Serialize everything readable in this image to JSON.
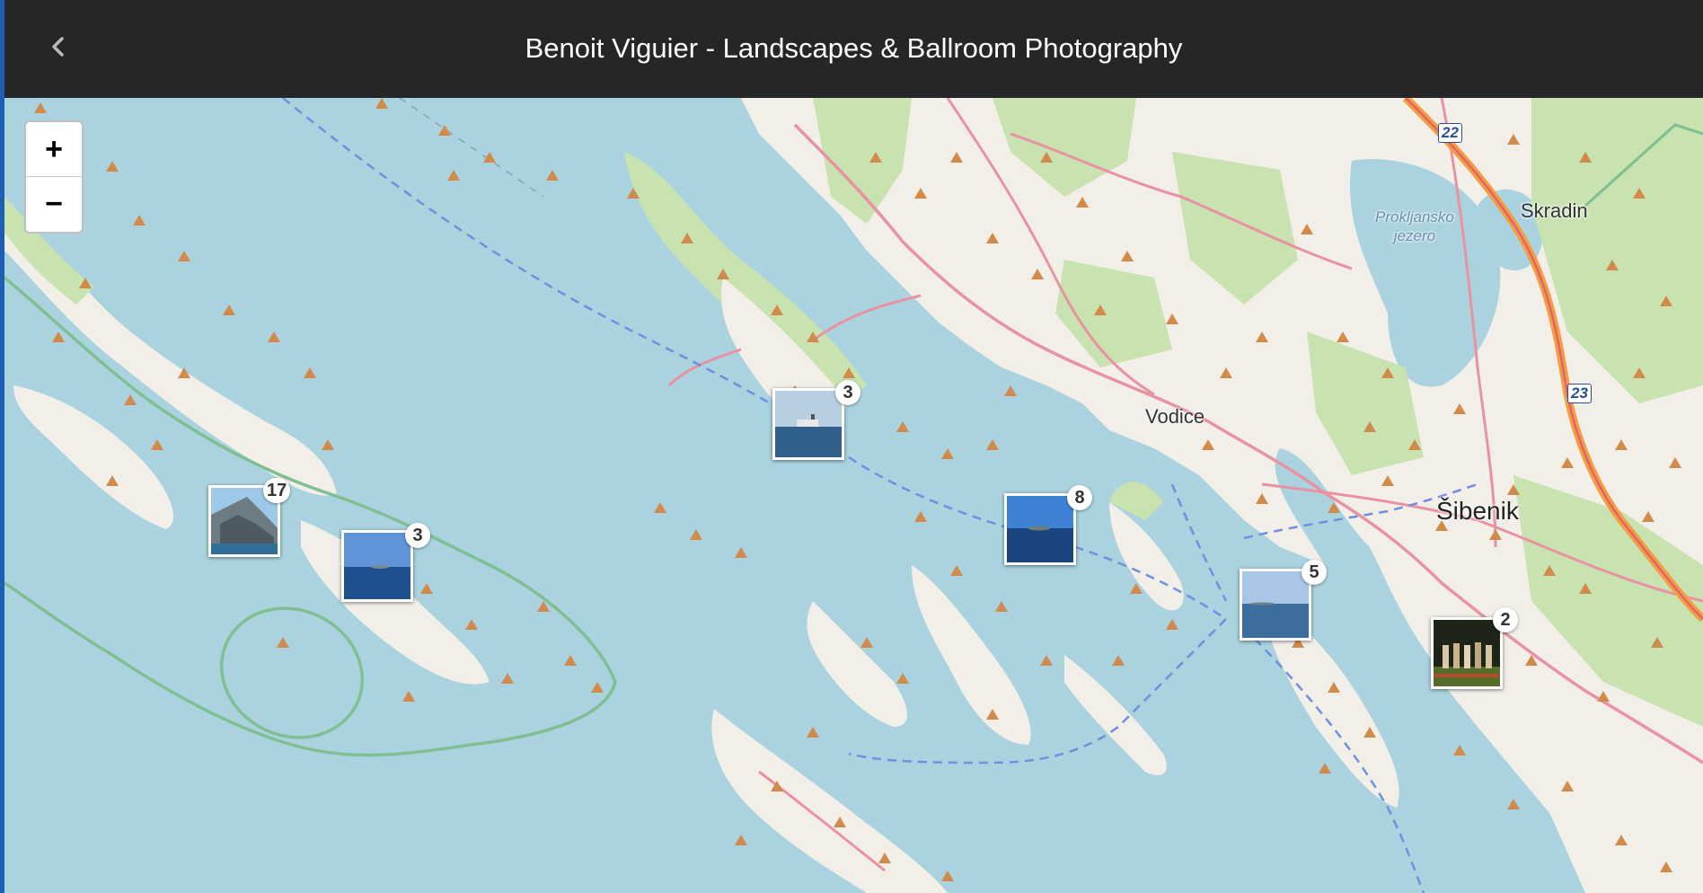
{
  "header": {
    "title": "Benoit Viguier - Landscapes & Ballroom Photography",
    "back_icon": "chevron-left-icon"
  },
  "map": {
    "zoom_in_label": "+",
    "zoom_out_label": "−",
    "places": {
      "vodice": "Vodice",
      "sibenik": "Šibenik",
      "skradin": "Skradin",
      "lake_line1": "Prokljansko",
      "lake_line2": "jezero"
    },
    "roads": {
      "r22": "22",
      "r23": "23"
    },
    "clusters": [
      {
        "count": "17",
        "photo": "cliff"
      },
      {
        "count": "3",
        "photo": "sea"
      },
      {
        "count": "3",
        "photo": "boat"
      },
      {
        "count": "8",
        "photo": "sea"
      },
      {
        "count": "5",
        "photo": "sea"
      },
      {
        "count": "2",
        "photo": "people"
      }
    ]
  },
  "colors": {
    "water": "#aad3df",
    "land": "#f2efe9",
    "forest": "#c8e2b0",
    "road": "#e892a2",
    "motorway": "#f0a040",
    "ferry": "#6f8fe0",
    "peak": "#d18a4a"
  }
}
